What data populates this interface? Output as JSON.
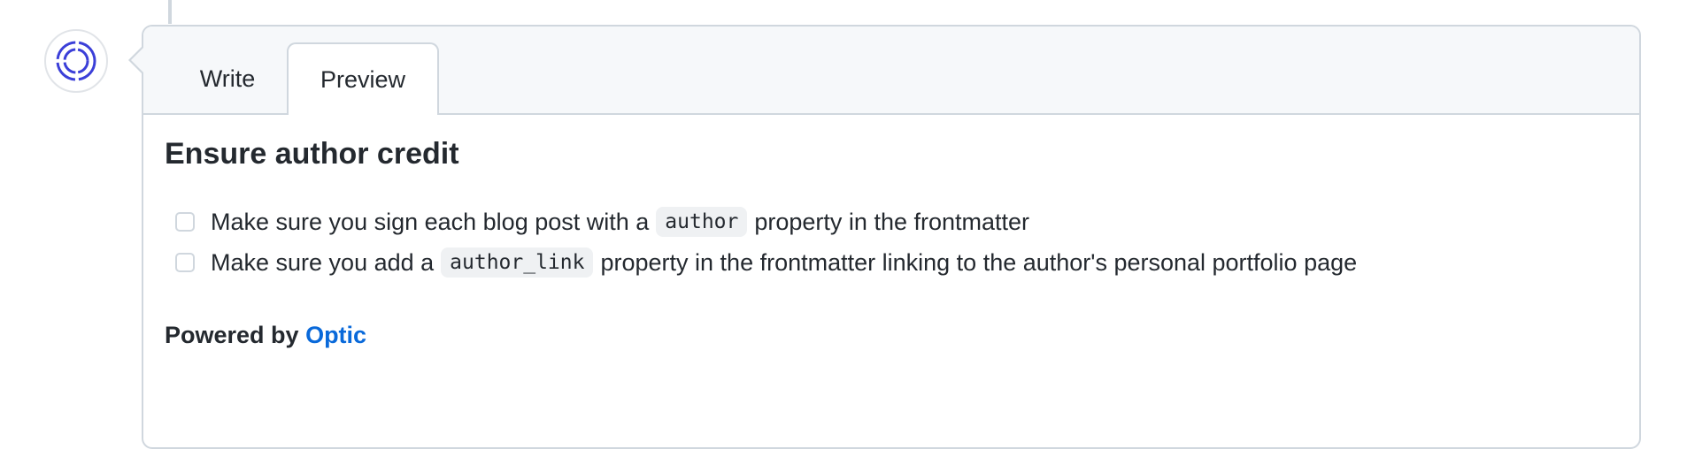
{
  "tabs": {
    "write_label": "Write",
    "preview_label": "Preview",
    "active": "Preview"
  },
  "preview": {
    "heading": "Ensure author credit",
    "tasks": [
      {
        "text_before": "Make sure you sign each blog post with a",
        "code": "author",
        "text_after": "property in the frontmatter",
        "checked": false
      },
      {
        "text_before": "Make sure you add a",
        "code": "author_link",
        "text_after": "property in the frontmatter linking to the author's personal portfolio page",
        "checked": false
      }
    ],
    "powered_by_prefix": "Powered by",
    "powered_by_link": "Optic"
  },
  "avatar": {
    "icon": "optic-ring-logo",
    "color": "#3b3fd8"
  },
  "colors": {
    "link": "#0969da",
    "border": "#d0d7de",
    "header_bg": "#f6f8fa"
  }
}
